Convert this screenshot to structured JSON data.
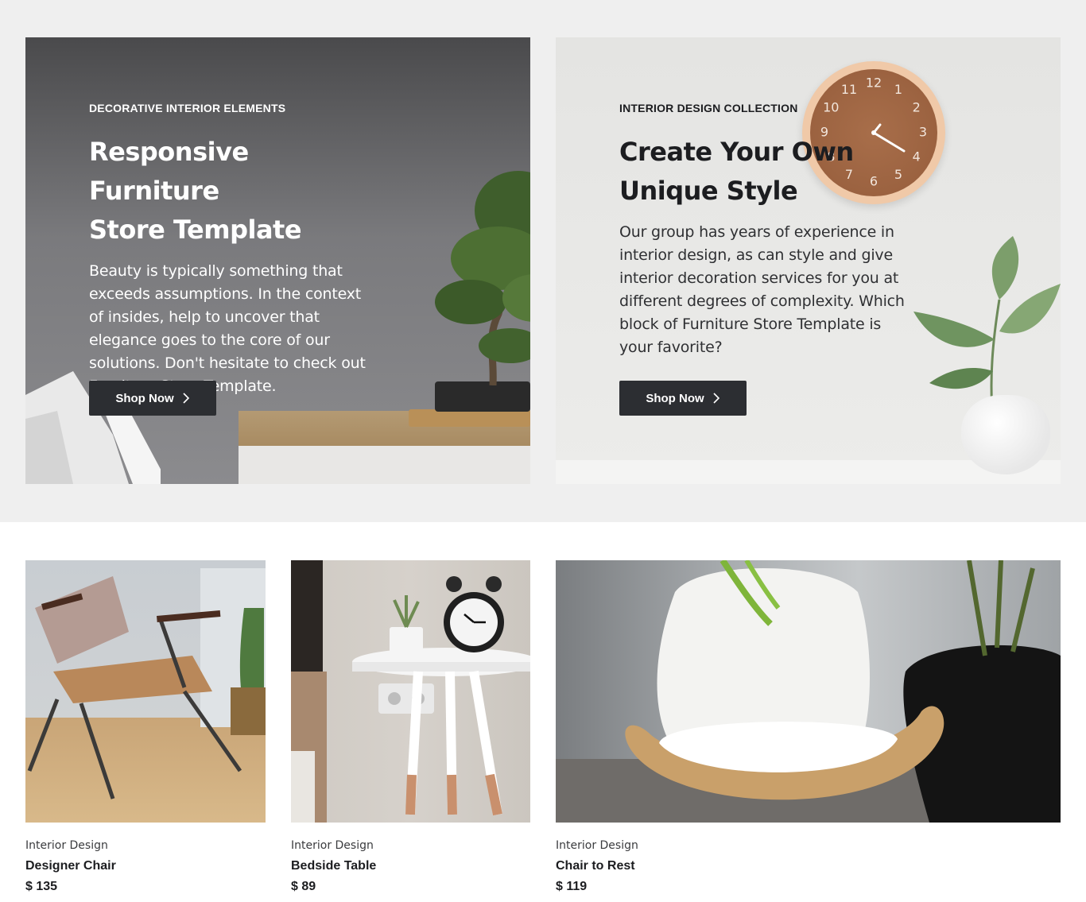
{
  "promos": [
    {
      "eyebrow": "DECORATIVE INTERIOR ELEMENTS",
      "title_line1": "Responsive Furniture",
      "title_line2": "Store Template",
      "description": "Beauty is typically something that exceeds assumptions. In the context of insides, help to uncover that elegance goes to the core of our solutions. Don't hesitate to check out Furniture Store Template.",
      "button_label": "Shop Now",
      "button_icon": "chevron-right-icon"
    },
    {
      "eyebrow": "INTERIOR DESIGN COLLECTION",
      "title_line1": "Create Your Own",
      "title_line2": "Unique Style",
      "description": "Our group has years of experience in interior design, as can style and give interior decoration services for you at different degrees of complexity. Which block of Furniture Store Template is your favorite?",
      "button_label": "Shop Now",
      "button_icon": "chevron-right-icon"
    }
  ],
  "clock_numbers": [
    "12",
    "1",
    "2",
    "3",
    "4",
    "5",
    "6",
    "7",
    "8",
    "9",
    "10",
    "11"
  ],
  "products": [
    {
      "category": "Interior Design",
      "name": "Designer Chair",
      "price": "$ 135"
    },
    {
      "category": "Interior Design",
      "name": "Bedside Table",
      "price": "$ 89"
    },
    {
      "category": "Interior Design",
      "name": "Chair to Rest",
      "price": "$ 119"
    }
  ],
  "colors": {
    "band_background": "#efefef",
    "button_background": "#2c2e32",
    "text_dark": "#1c1d20"
  }
}
